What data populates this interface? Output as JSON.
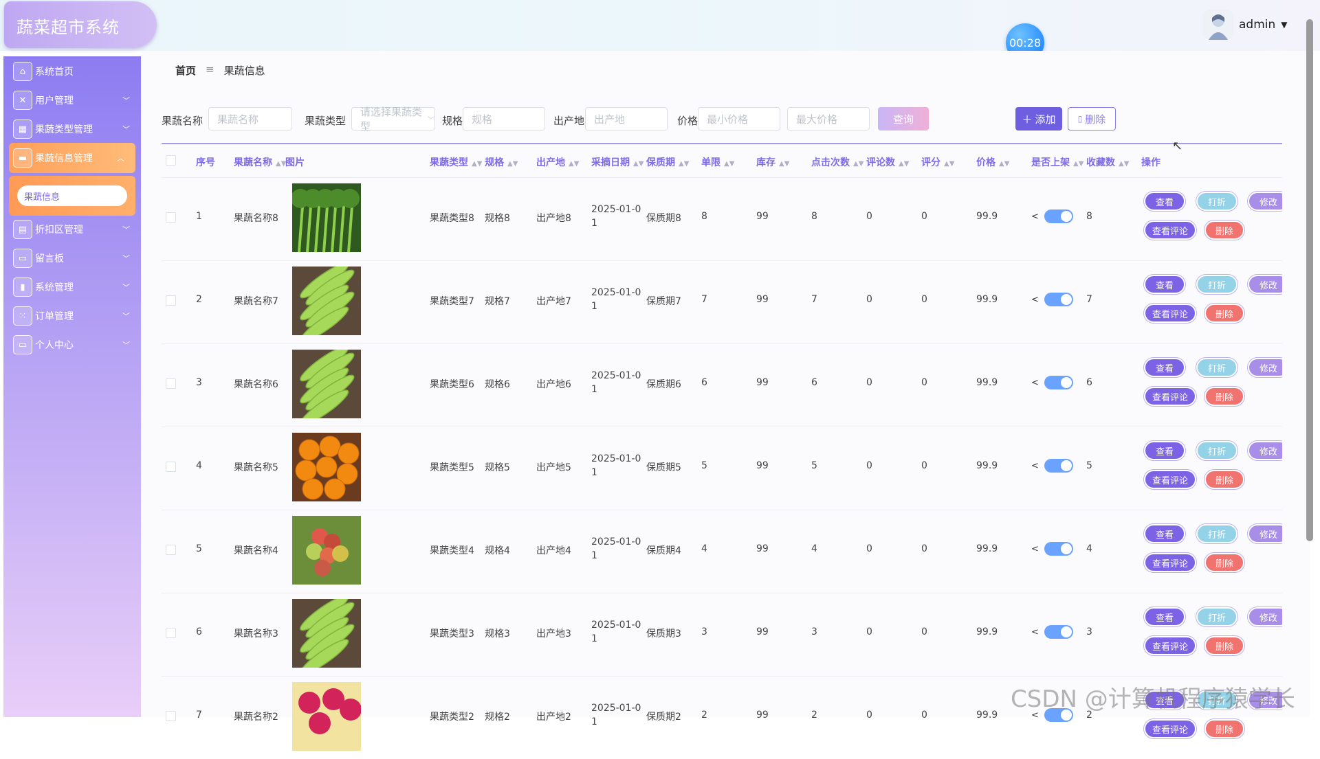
{
  "app": {
    "title": "蔬菜超市系统"
  },
  "timer": "00:28",
  "user": {
    "name": "admin"
  },
  "sidebar": {
    "items": [
      {
        "label": "系统首页",
        "icon": "home-icon",
        "expandable": false
      },
      {
        "label": "用户管理",
        "icon": "clipboard-icon",
        "expandable": true
      },
      {
        "label": "果蔬类型管理",
        "icon": "grid-icon",
        "expandable": true
      },
      {
        "label": "果蔬信息管理",
        "icon": "monitor-icon",
        "expandable": true,
        "active": true
      },
      {
        "label": "折扣区管理",
        "icon": "briefcase-icon",
        "expandable": true
      },
      {
        "label": "留言板",
        "icon": "message-icon",
        "expandable": true
      },
      {
        "label": "系统管理",
        "icon": "bar-chart-icon",
        "expandable": true
      },
      {
        "label": "订单管理",
        "icon": "apps-icon",
        "expandable": true
      },
      {
        "label": "个人中心",
        "icon": "card-icon",
        "expandable": true
      }
    ],
    "sub_item": "果蔬信息"
  },
  "breadcrumb": {
    "home": "首页",
    "separator": "≡",
    "current": "果蔬信息"
  },
  "search": {
    "name_label": "果蔬名称",
    "name_placeholder": "果蔬名称",
    "type_label": "果蔬类型",
    "type_placeholder": "请选择果蔬类型",
    "spec_label": "规格",
    "spec_placeholder": "规格",
    "origin_label": "出产地",
    "origin_placeholder": "出产地",
    "price_label": "价格",
    "min_price_placeholder": "最小价格",
    "max_price_placeholder": "最大价格",
    "query_button": "查询",
    "add_button": "添加",
    "delete_button": "删除"
  },
  "table": {
    "columns": [
      "序号",
      "果蔬名称",
      "图片",
      "果蔬类型",
      "规格",
      "出产地",
      "采摘日期",
      "保质期",
      "单限",
      "库存",
      "点击次数",
      "评论数",
      "评分",
      "价格",
      "是否上架",
      "收藏数",
      "操作"
    ],
    "rows": [
      {
        "no": "1",
        "name": "果蔬名称8",
        "image": "celery",
        "type": "果蔬类型8",
        "spec": "规格8",
        "origin": "出产地8",
        "date_line1": "2025-01-0",
        "date_line2": "1",
        "shelf": "保质期8",
        "limit": "8",
        "stock": "99",
        "clicks": "8",
        "comments": "0",
        "rating": "0",
        "price": "99.9",
        "on_sale": true,
        "favorites": "8"
      },
      {
        "no": "2",
        "name": "果蔬名称7",
        "image": "eggplant",
        "type": "果蔬类型7",
        "spec": "规格7",
        "origin": "出产地7",
        "date_line1": "2025-01-0",
        "date_line2": "1",
        "shelf": "保质期7",
        "limit": "7",
        "stock": "99",
        "clicks": "7",
        "comments": "0",
        "rating": "0",
        "price": "99.9",
        "on_sale": true,
        "favorites": "7"
      },
      {
        "no": "3",
        "name": "果蔬名称6",
        "image": "eggplant",
        "type": "果蔬类型6",
        "spec": "规格6",
        "origin": "出产地6",
        "date_line1": "2025-01-0",
        "date_line2": "1",
        "shelf": "保质期6",
        "limit": "6",
        "stock": "99",
        "clicks": "6",
        "comments": "0",
        "rating": "0",
        "price": "99.9",
        "on_sale": true,
        "favorites": "6"
      },
      {
        "no": "4",
        "name": "果蔬名称5",
        "image": "oranges",
        "type": "果蔬类型5",
        "spec": "规格5",
        "origin": "出产地5",
        "date_line1": "2025-01-0",
        "date_line2": "1",
        "shelf": "保质期5",
        "limit": "5",
        "stock": "99",
        "clicks": "5",
        "comments": "0",
        "rating": "0",
        "price": "99.9",
        "on_sale": true,
        "favorites": "5"
      },
      {
        "no": "5",
        "name": "果蔬名称4",
        "image": "grapes",
        "type": "果蔬类型4",
        "spec": "规格4",
        "origin": "出产地4",
        "date_line1": "2025-01-0",
        "date_line2": "1",
        "shelf": "保质期4",
        "limit": "4",
        "stock": "99",
        "clicks": "4",
        "comments": "0",
        "rating": "0",
        "price": "99.9",
        "on_sale": true,
        "favorites": "4"
      },
      {
        "no": "6",
        "name": "果蔬名称3",
        "image": "eggplant",
        "type": "果蔬类型3",
        "spec": "规格3",
        "origin": "出产地3",
        "date_line1": "2025-01-0",
        "date_line2": "1",
        "shelf": "保质期3",
        "limit": "3",
        "stock": "99",
        "clicks": "3",
        "comments": "0",
        "rating": "0",
        "price": "99.9",
        "on_sale": true,
        "favorites": "3"
      },
      {
        "no": "7",
        "name": "果蔬名称2",
        "image": "dragonfruit",
        "type": "果蔬类型2",
        "spec": "规格2",
        "origin": "出产地2",
        "date_line1": "2025-01-0",
        "date_line2": "1",
        "shelf": "保质期2",
        "limit": "2",
        "stock": "99",
        "clicks": "2",
        "comments": "0",
        "rating": "0",
        "price": "99.9",
        "on_sale": true,
        "favorites": "2"
      }
    ],
    "actions": {
      "view": "查看",
      "discount": "打折",
      "edit": "修改",
      "comments": "查看评论",
      "delete": "删除"
    }
  },
  "watermark": "CSDN @计算机程序猿学长",
  "colors": {
    "accent": "#7e6be8",
    "sidebar_active": "#ff9f5a",
    "danger": "#f1736f",
    "toggle_on": "#6aa3ff"
  }
}
